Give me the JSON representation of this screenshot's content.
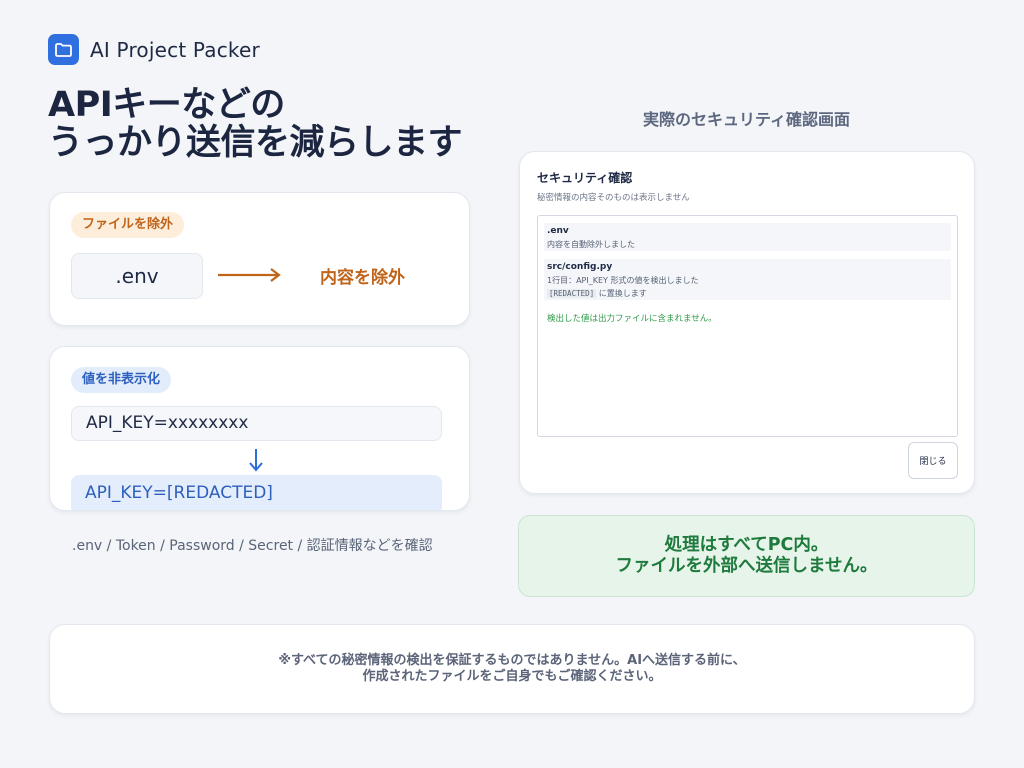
{
  "app": {
    "name": "AI Project Packer",
    "icon": "folder-icon",
    "accent": "#2f6fe0"
  },
  "hero": {
    "line1": "APIキーなどの",
    "line2": "うっかり送信を減らします"
  },
  "exclude_card": {
    "chip": "ファイルを除外",
    "file": ".env",
    "arrow_icon": "arrow-right-icon",
    "result": "内容を除外",
    "color": "#c0641a"
  },
  "mask_card": {
    "chip": "値を非表示化",
    "before": "API_KEY=xxxxxxxx",
    "arrow_icon": "arrow-down-icon",
    "after": "API_KEY=[REDACTED]",
    "color": "#2d5fbd"
  },
  "checked_items": ".env / Token / Password / Secret / 認証情報などを確認",
  "screen_title": "実際のセキュリティ確認画面",
  "dialog": {
    "title": "セキュリティ確認",
    "subtitle": "秘密情報の内容そのものは表示しません",
    "rows": [
      {
        "name": ".env",
        "detail": "内容を自動除外しました"
      },
      {
        "name": "src/config.py",
        "detail": "1行目：API_KEY 形式の値を検出しました",
        "token": "[REDACTED]",
        "detail2": "に置換します"
      }
    ],
    "ok_note": "検出した値は出力ファイルに含まれません。",
    "close_label": "閉じる"
  },
  "local_note": {
    "line1": "処理はすべてPC内。",
    "line2": "ファイルを外部へ送信しません。",
    "color": "#1f7a3d"
  },
  "disclaimer": {
    "line1": "※すべての秘密情報の検出を保証するものではありません。AIへ送信する前に、",
    "line2": "作成されたファイルをご自身でもご確認ください。"
  }
}
